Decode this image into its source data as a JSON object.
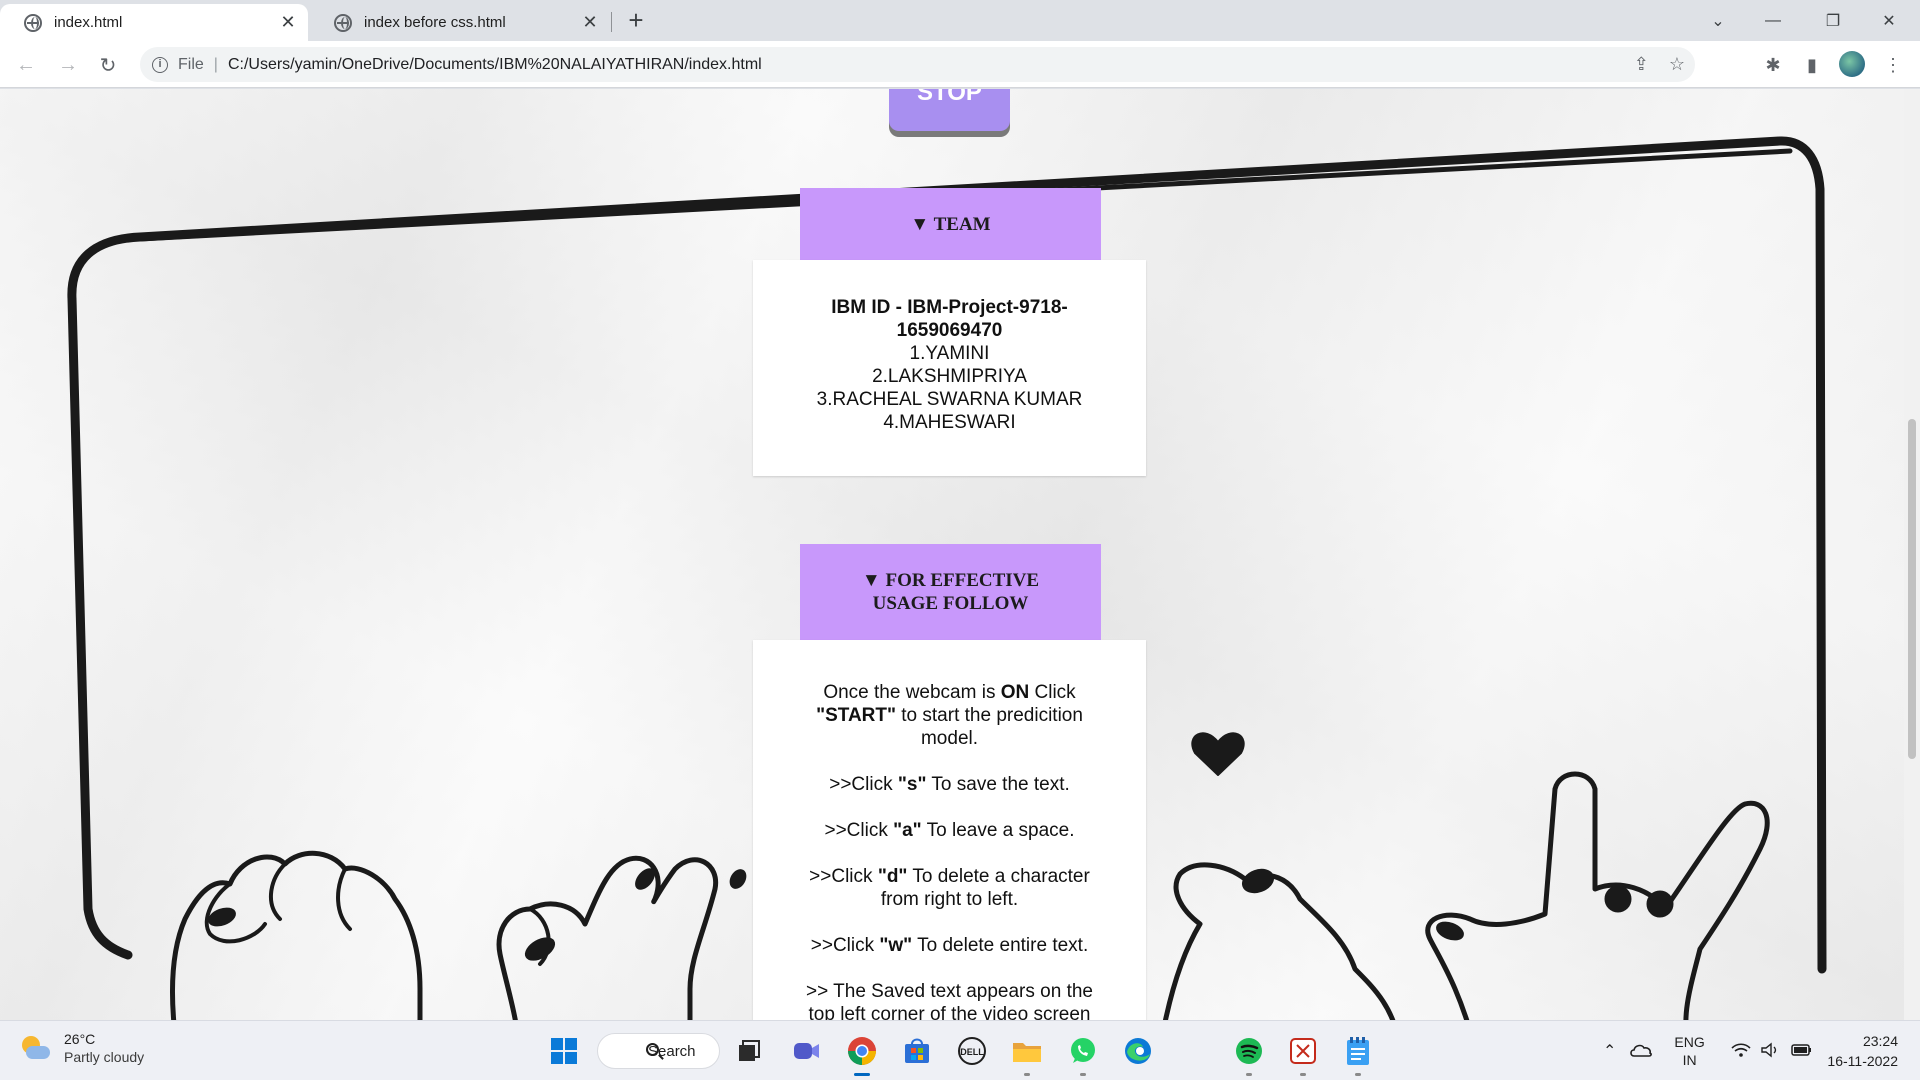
{
  "browser": {
    "tabs": [
      {
        "title": "index.html",
        "active": true
      },
      {
        "title": "index before css.html",
        "active": false
      }
    ],
    "new_tab": "+",
    "close_glyph": "✕",
    "url_scheme": "File",
    "url": "C:/Users/yamin/OneDrive/Documents/IBM%20NALAIYATHIRAN/index.html",
    "window_controls": [
      "⌄",
      "—",
      "❐",
      "✕"
    ]
  },
  "page": {
    "stop_button": "STOP",
    "team": {
      "summary": "▼ TEAM",
      "ibm_id": "IBM ID - IBM-Project-9718-1659069470",
      "members": [
        "1.YAMINI",
        "2.LAKSHMIPRIYA",
        "3.RACHEAL SWARNA KUMAR",
        "4.MAHESWARI"
      ]
    },
    "usage": {
      "summary": "▼ FOR EFFECTIVE USAGE FOLLOW",
      "intro_1": "Once the webcam is ",
      "intro_on": "ON",
      "intro_2": " Click ",
      "intro_start": "\"START\"",
      "intro_3": " to start the predicition model.",
      "rules": [
        {
          "pre": ">>Click ",
          "key": "\"s\"",
          "post": " To save the text."
        },
        {
          "pre": ">>Click ",
          "key": "\"a\"",
          "post": " To leave a space."
        },
        {
          "pre": ">>Click ",
          "key": "\"d\"",
          "post": " To delete a character from right to left."
        },
        {
          "pre": ">>Click ",
          "key": "\"w\"",
          "post": " To delete entire text."
        }
      ],
      "saved_note": ">> The Saved text appears on the top left corner of the video screen"
    },
    "colors": {
      "summary_bg": "#c898fb",
      "stop_bg": "#a88ff0",
      "panel_bg": "#ffffff"
    }
  },
  "taskbar": {
    "weather_temp": "26°C",
    "weather_cond": "Partly cloudy",
    "search_label": "Search",
    "lang_1": "ENG",
    "lang_2": "IN",
    "time": "23:24",
    "date": "16-11-2022",
    "apps": [
      "start-icon",
      "search-icon",
      "task-view-icon",
      "meet-icon",
      "chrome-icon",
      "store-icon",
      "dell-icon",
      "file-explorer-icon",
      "whatsapp-icon",
      "edge-icon",
      "spotify-icon",
      "snipping-icon",
      "notepad-icon"
    ]
  }
}
